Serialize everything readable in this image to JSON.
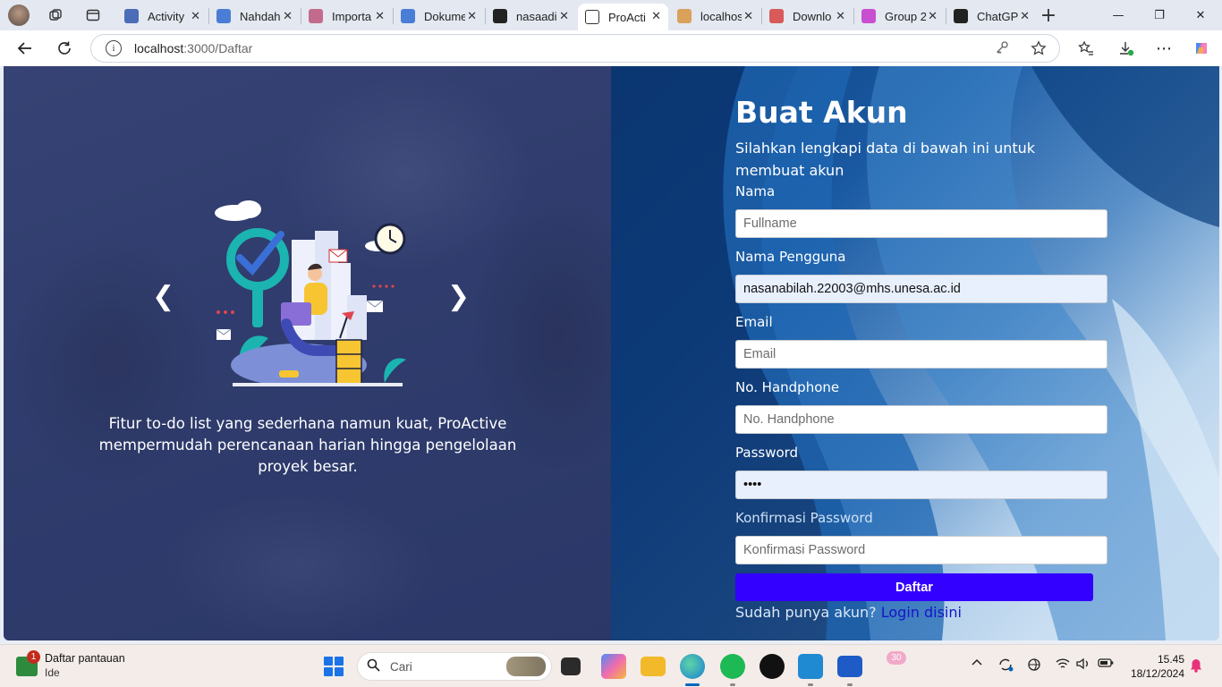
{
  "browser": {
    "tabs": [
      {
        "label": "Activity",
        "favicon_color": "#4b6cb7"
      },
      {
        "label": "Nahdah",
        "favicon_color": "#4a7dd6"
      },
      {
        "label": "Importa",
        "favicon_color": "#c36b8d"
      },
      {
        "label": "Dokume",
        "favicon_color": "#4a7dd6"
      },
      {
        "label": "nasaadi",
        "favicon_color": "#222222"
      },
      {
        "label": "ProActi",
        "favicon_color": "#ffffff"
      },
      {
        "label": "localhos",
        "favicon_color": "#d9a15a"
      },
      {
        "label": "Downlo",
        "favicon_color": "#d85a5a"
      },
      {
        "label": "Group 2",
        "favicon_color": "#c94fd1"
      },
      {
        "label": "ChatGP",
        "favicon_color": "#222222"
      }
    ],
    "active_tab_index": 5,
    "url_host": "localhost",
    "url_path": ":3000/Daftar"
  },
  "carousel": {
    "caption": "Fitur to-do list yang sederhana namun kuat, ProActive mempermudah perencanaan harian hingga pengelolaan proyek besar.",
    "prev_glyph": "❮",
    "next_glyph": "❯"
  },
  "form": {
    "title": "Buat Akun",
    "subtitle": "Silahkan lengkapi data di bawah ini untuk membuat akun",
    "fields": {
      "fullname": {
        "label": "Nama",
        "placeholder": "Fullname",
        "value": ""
      },
      "username": {
        "label": "Nama Pengguna",
        "placeholder": "",
        "value": "nasanabilah.22003@mhs.unesa.ac.id"
      },
      "email": {
        "label": "Email",
        "placeholder": "Email",
        "value": ""
      },
      "phone": {
        "label": "No. Handphone",
        "placeholder": "No. Handphone",
        "value": ""
      },
      "password": {
        "label": "Password",
        "placeholder": "",
        "value": "abcd"
      },
      "confirm": {
        "label": "Konfirmasi Password",
        "placeholder": "Konfirmasi Password",
        "value": ""
      }
    },
    "submit_label": "Daftar",
    "login_prompt": "Sudah punya akun?",
    "login_link": "Login disini",
    "accent_color": "#3300ff"
  },
  "taskbar": {
    "widget_badge": "1",
    "widget_title": "Daftar pantauan",
    "widget_subtitle": "Ide",
    "search_placeholder": "Cari",
    "notification_badge": "30",
    "time": "15.45",
    "date": "18/12/2024"
  }
}
